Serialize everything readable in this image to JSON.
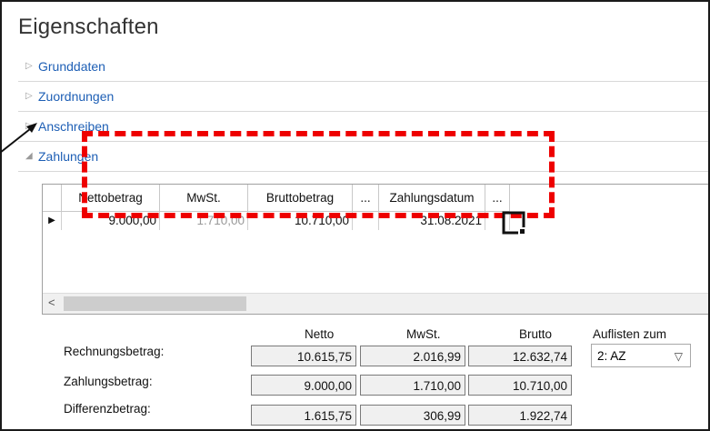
{
  "title": "Eigenschaften",
  "sections": [
    {
      "label": "Grunddaten",
      "expanded": false
    },
    {
      "label": "Zuordnungen",
      "expanded": false
    },
    {
      "label": "Anschreiben",
      "expanded": false
    },
    {
      "label": "Zahlungen",
      "expanded": true
    }
  ],
  "grid": {
    "headers": {
      "netto": "Nettobetrag",
      "mwst": "MwSt.",
      "brutto": "Bruttobetrag",
      "ellipsis1": "...",
      "datum": "Zahlungsdatum",
      "ellipsis2": "..."
    },
    "rows": [
      {
        "indicator": "▶",
        "netto": "9.000,00",
        "mwst": "1.710,00",
        "brutto": "10.710,00",
        "datum": "31.08.2021"
      }
    ],
    "scroll_left": "<"
  },
  "summary": {
    "headers": {
      "netto": "Netto",
      "mwst": "MwSt.",
      "brutto": "Brutto",
      "auflisten": "Auflisten zum"
    },
    "rechnungsbetrag": {
      "label": "Rechnungsbetrag:",
      "netto": "10.615,75",
      "mwst": "2.016,99",
      "brutto": "12.632,74"
    },
    "zahlungsbetrag": {
      "label": "Zahlungsbetrag:",
      "netto": "9.000,00",
      "mwst": "1.710,00",
      "brutto": "10.710,00"
    },
    "differenzbetrag": {
      "label": "Differenzbetrag:",
      "netto": "1.615,75",
      "mwst": "306,99",
      "brutto": "1.922,74"
    },
    "auflisten_value": "2: AZ"
  },
  "colors": {
    "link": "#1e5fb5",
    "annotation": "#ee0000"
  },
  "icons": {
    "collapsed": "triangle-right-icon",
    "expanded": "triangle-down-icon",
    "row_current": "row-indicator-icon",
    "dropdown": "chevron-down-icon"
  }
}
